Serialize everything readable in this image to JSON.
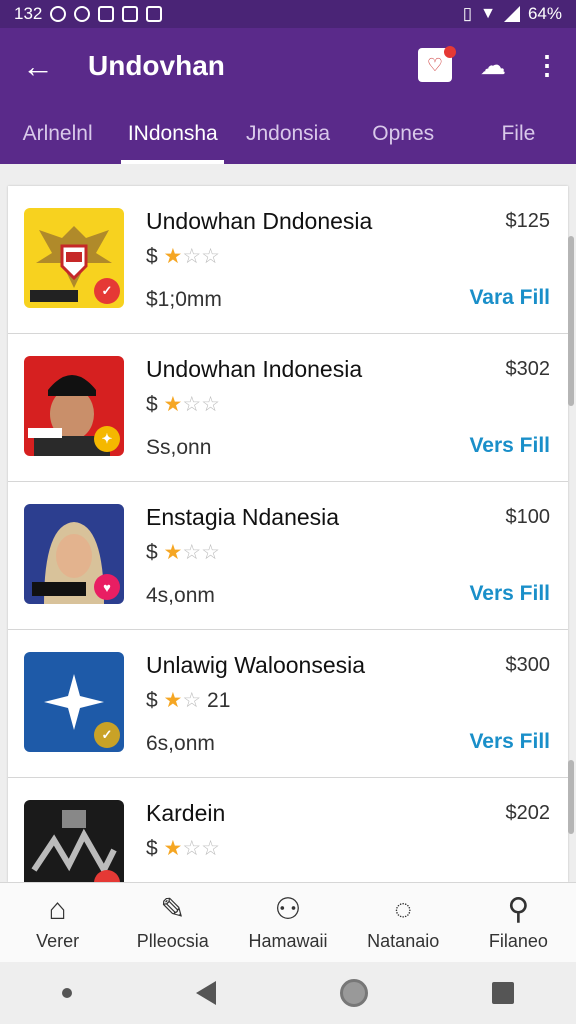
{
  "status_bar": {
    "time": "132",
    "battery": "64%"
  },
  "app_bar": {
    "title": "Undovhan"
  },
  "tabs": [
    {
      "label": "Arlnelnl"
    },
    {
      "label": "INdonsha"
    },
    {
      "label": "Jndonsia"
    },
    {
      "label": "Opnes"
    },
    {
      "label": "File"
    }
  ],
  "list": [
    {
      "name": "Undowhan Dndonesia",
      "price": "$125",
      "rating_prefix": "$",
      "rating_suffix": "",
      "sub": "$1;0mm",
      "link": "Vara Fill",
      "thumb_bg": "#f7d21f",
      "badge_color": "#e53935"
    },
    {
      "name": "Undowhan Indonesia",
      "price": "$302",
      "rating_prefix": "$",
      "rating_suffix": "",
      "sub": "Ss,onn",
      "link": "Vers Fill",
      "thumb_bg": "#d62020",
      "badge_color": "#f5b800"
    },
    {
      "name": "Enstagia Ndanesia",
      "price": "$100",
      "rating_prefix": "$",
      "rating_suffix": "",
      "sub": "4s,onm",
      "link": "Vers Fill",
      "thumb_bg": "#2c3e8f",
      "badge_color": "#e91e63"
    },
    {
      "name": "Unlawig Waloonsesia",
      "price": "$300",
      "rating_prefix": "$",
      "rating_suffix": "21",
      "sub": "6s,onm",
      "link": "Vers Fill",
      "thumb_bg": "#1e5aa8",
      "badge_color": "#c9a227"
    },
    {
      "name": "Kardein",
      "price": "$202",
      "rating_prefix": "$",
      "rating_suffix": "",
      "sub": "",
      "link": "",
      "thumb_bg": "#1a1a1a",
      "badge_color": "#e53935"
    }
  ],
  "bottom_nav": [
    {
      "label": "Verer",
      "icon": "home-icon"
    },
    {
      "label": "Plleocsia",
      "icon": "edit-icon"
    },
    {
      "label": "Hamawaii",
      "icon": "people-icon"
    },
    {
      "label": "Natanaio",
      "icon": "dots-circle-icon"
    },
    {
      "label": "Filaneo",
      "icon": "search-icon"
    }
  ]
}
